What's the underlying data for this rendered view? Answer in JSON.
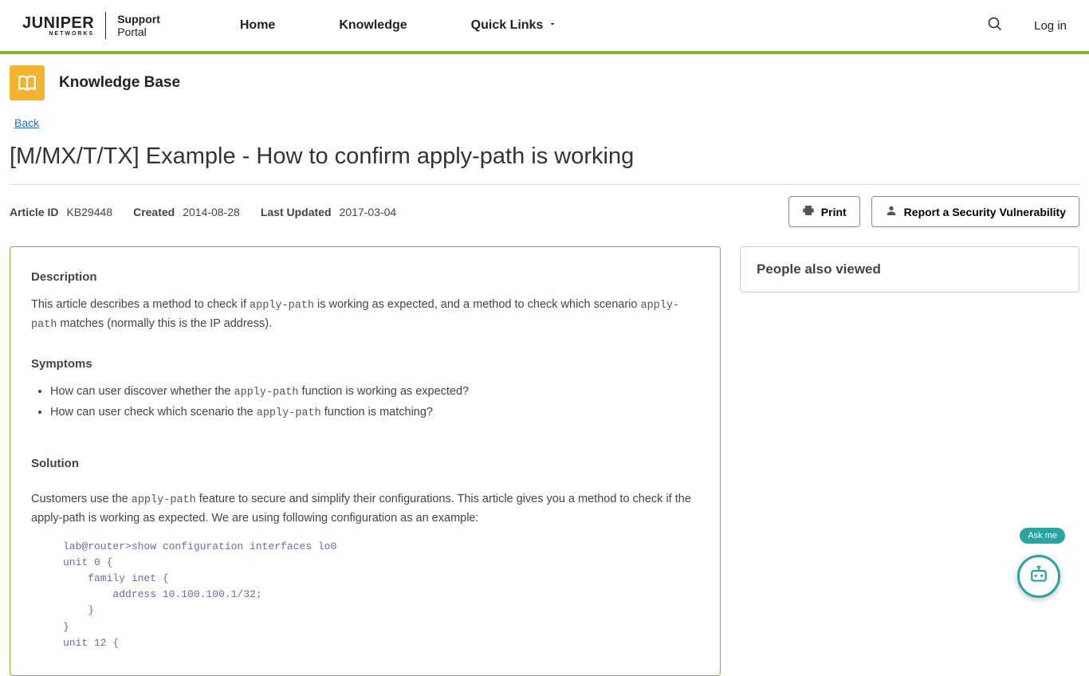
{
  "brand": {
    "name": "JUNIPER",
    "sub": "NETWORKS",
    "portal_top": "Support",
    "portal_bottom": "Portal"
  },
  "nav": {
    "home": "Home",
    "knowledge": "Knowledge",
    "quick": "Quick Links"
  },
  "auth": {
    "login": "Log in"
  },
  "kb": {
    "section": "Knowledge Base",
    "back": "Back"
  },
  "article": {
    "title": "[M/MX/T/TX] Example - How to confirm apply-path is working",
    "meta": {
      "id_label": "Article ID",
      "id": "KB29448",
      "created_label": "Created",
      "created": "2014-08-28",
      "updated_label": "Last Updated",
      "updated": "2017-03-04"
    },
    "actions": {
      "print": "Print",
      "report": "Report a Security Vulnerability"
    },
    "headings": {
      "description": "Description",
      "symptoms": "Symptoms",
      "solution": "Solution"
    },
    "desc": {
      "p1a": "This article describes a method to check if ",
      "code1": "apply-path",
      "p1b": " is working as expected, and a method to check which scenario ",
      "code2": "apply-path",
      "p1c": " matches (normally this is the IP address)."
    },
    "symptoms": {
      "li1a": "How can user discover whether the ",
      "li1code": "apply-path",
      "li1b": " function is working as expected?",
      "li2a": "How can user check which scenario the ",
      "li2code": "apply-path",
      "li2b": " function is matching?"
    },
    "solution": {
      "p1a": "Customers use the ",
      "code1": "apply-path",
      "p1b": " feature to secure and simplify their configurations. This article gives you a method to check if the apply-path is working as expected. We are using following configuration as an example:",
      "code_block": "lab@router>show configuration interfaces lo0\nunit 0 {\n    family inet {\n        address 10.100.100.1/32;\n    }\n}\nunit 12 {"
    }
  },
  "side": {
    "title": "People also viewed"
  },
  "chat": {
    "label": "Ask me"
  }
}
